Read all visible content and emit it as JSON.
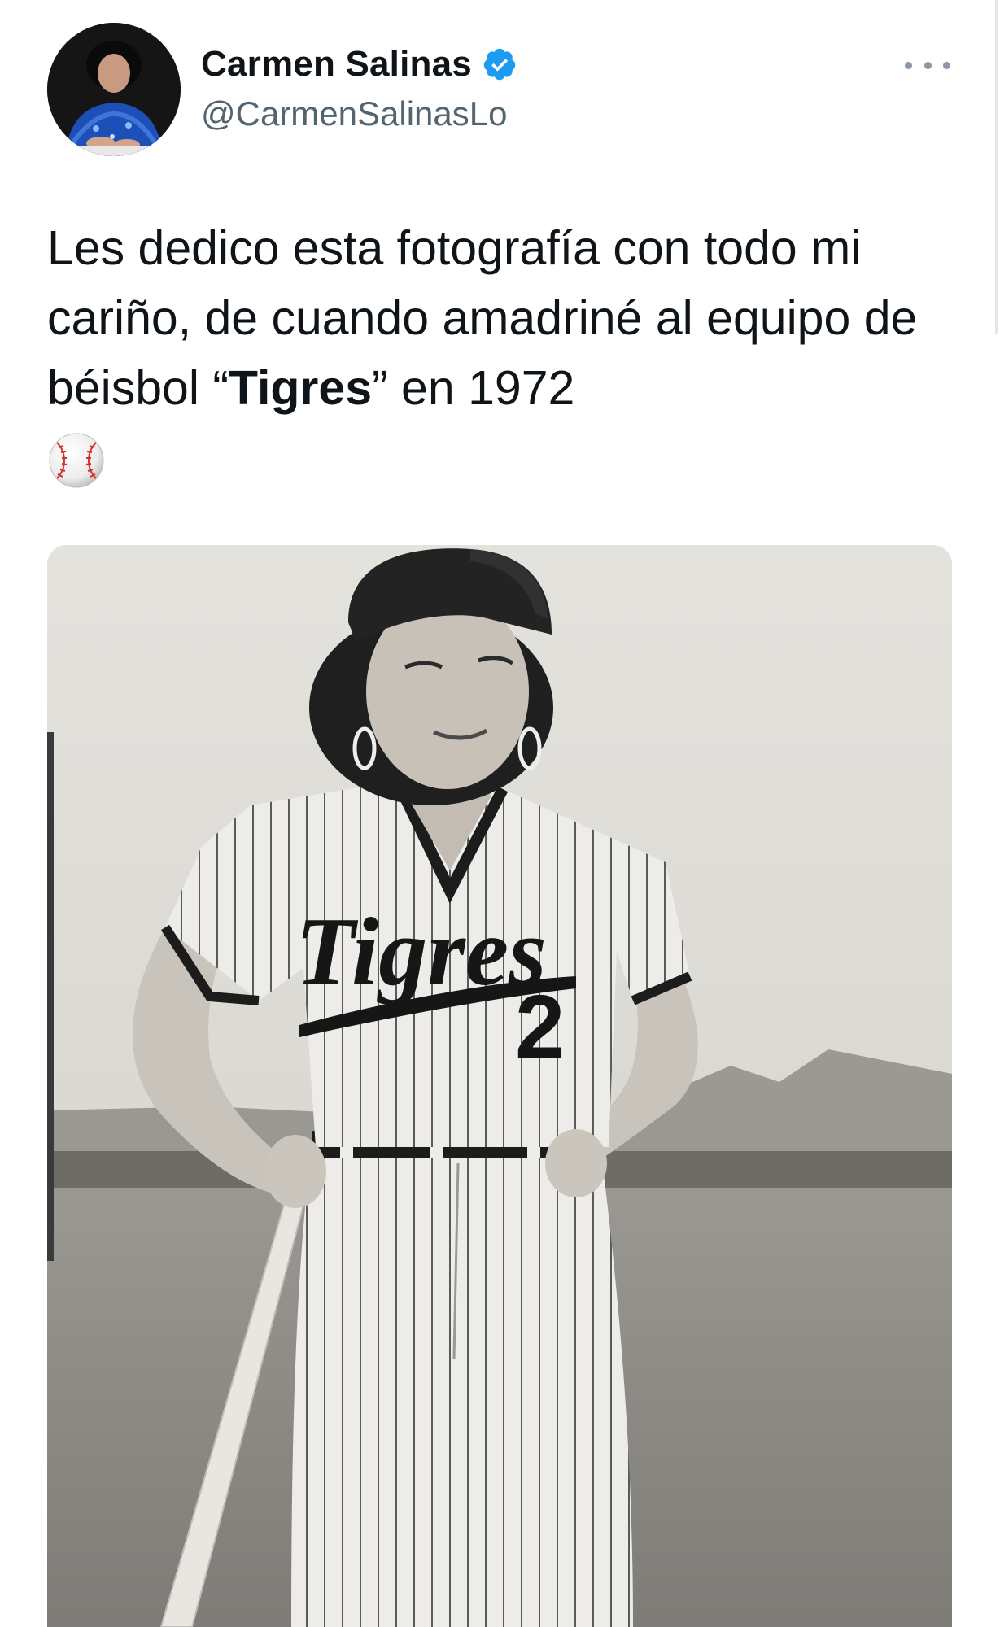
{
  "author": {
    "name": "Carmen Salinas",
    "handle": "@CarmenSalinasLo",
    "verified": true,
    "avatar_icon": "profile-photo"
  },
  "menu": {
    "icon": "more-horizontal-icon"
  },
  "tweet": {
    "text_before": "Les dedico esta fotografía con todo mi cariño, de cuando amadriné al equipo de béisbol “",
    "text_bold": "Tigres",
    "text_after": "” en 1972",
    "emoji": "baseball-icon"
  },
  "photo": {
    "jersey_text": "Tigres",
    "jersey_number": "2"
  },
  "colors": {
    "verified_blue": "#1d9bf0",
    "secondary_text": "#536471",
    "primary_text": "#0f1419"
  }
}
